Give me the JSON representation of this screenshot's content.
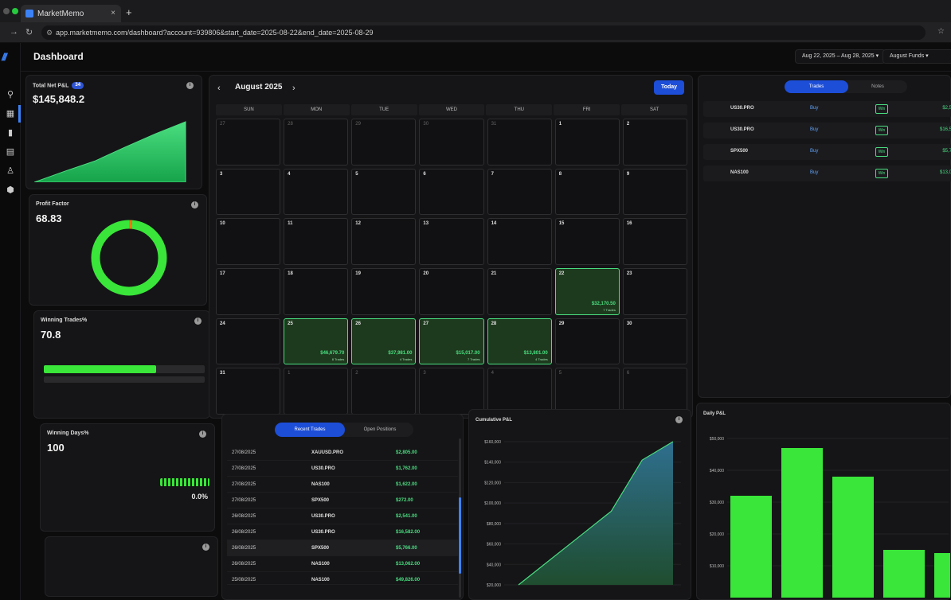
{
  "browser": {
    "tab_title": "MarketMemo",
    "url": "app.marketmemo.com/dashboard?account=939806&start_date=2025-08-22&end_date=2025-08-29"
  },
  "header": {
    "title": "Dashboard",
    "date_range": "Aug 22, 2025 – Aug 28, 2025 ▾",
    "account": "August Funds ▾"
  },
  "stats": {
    "net_pnl": {
      "label": "Total Net P&L",
      "badge": "34",
      "value": "$145,848.2"
    },
    "profit_factor": {
      "label": "Profit Factor",
      "value": "68.83"
    },
    "winning_trades": {
      "label": "Winning Trades%",
      "value": "70.8"
    },
    "winning_days": {
      "label": "Winning Days%",
      "value": "100",
      "side_value": "0.0%"
    }
  },
  "calendar": {
    "month": "August 2025",
    "today_label": "Today",
    "weekdays": [
      "SUN",
      "MON",
      "TUE",
      "WED",
      "THU",
      "FRI",
      "SAT"
    ],
    "days": [
      {
        "n": "27",
        "out": true
      },
      {
        "n": "28",
        "out": true
      },
      {
        "n": "29",
        "out": true
      },
      {
        "n": "30",
        "out": true
      },
      {
        "n": "31",
        "out": true
      },
      {
        "n": "1"
      },
      {
        "n": "2"
      },
      {
        "n": "3"
      },
      {
        "n": "4"
      },
      {
        "n": "5"
      },
      {
        "n": "6"
      },
      {
        "n": "7"
      },
      {
        "n": "8"
      },
      {
        "n": "9"
      },
      {
        "n": "10"
      },
      {
        "n": "11"
      },
      {
        "n": "12"
      },
      {
        "n": "13"
      },
      {
        "n": "14"
      },
      {
        "n": "15"
      },
      {
        "n": "16"
      },
      {
        "n": "17"
      },
      {
        "n": "18"
      },
      {
        "n": "19"
      },
      {
        "n": "20"
      },
      {
        "n": "21"
      },
      {
        "n": "22",
        "amt": "$32,170.50",
        "tr": "7 Trades"
      },
      {
        "n": "23"
      },
      {
        "n": "24"
      },
      {
        "n": "25",
        "amt": "$46,679.70",
        "tr": "8 Trades"
      },
      {
        "n": "26",
        "amt": "$37,981.00",
        "tr": "4 Trades"
      },
      {
        "n": "27",
        "amt": "$15,017.00",
        "tr": "7 Trades"
      },
      {
        "n": "28",
        "amt": "$13,801.00",
        "tr": "4 Trades"
      },
      {
        "n": "29"
      },
      {
        "n": "30"
      },
      {
        "n": "31"
      },
      {
        "n": "1",
        "out": true
      },
      {
        "n": "2",
        "out": true
      },
      {
        "n": "3",
        "out": true
      },
      {
        "n": "4",
        "out": true
      },
      {
        "n": "5",
        "out": true
      },
      {
        "n": "6",
        "out": true
      }
    ]
  },
  "trades_panel": {
    "tab_active": "Trades",
    "tab_inactive": "Notes",
    "rows": [
      {
        "symbol": "US30.PRO",
        "side": "Buy",
        "result": "Win",
        "amount": "$2,5"
      },
      {
        "symbol": "US30.PRO",
        "side": "Buy",
        "result": "Win",
        "amount": "$16,5"
      },
      {
        "symbol": "SPX500",
        "side": "Buy",
        "result": "Win",
        "amount": "$5,7"
      },
      {
        "symbol": "NAS100",
        "side": "Buy",
        "result": "Win",
        "amount": "$13,0"
      }
    ]
  },
  "recent": {
    "tab_active": "Recent Trades",
    "tab_inactive": "Open Positions",
    "rows": [
      {
        "date": "27/08/2025",
        "symbol": "XAUUSD.PRO",
        "pnl": "$2,805.00"
      },
      {
        "date": "27/08/2025",
        "symbol": "US30.PRO",
        "pnl": "$1,762.00"
      },
      {
        "date": "27/08/2025",
        "symbol": "NAS100",
        "pnl": "$1,622.00"
      },
      {
        "date": "27/08/2025",
        "symbol": "SPX500",
        "pnl": "$272.00"
      },
      {
        "date": "26/08/2025",
        "symbol": "US30.PRO",
        "pnl": "$2,541.00"
      },
      {
        "date": "26/08/2025",
        "symbol": "US30.PRO",
        "pnl": "$16,582.00"
      },
      {
        "date": "26/08/2025",
        "symbol": "SPX500",
        "pnl": "$5,766.00"
      },
      {
        "date": "26/08/2025",
        "symbol": "NAS100",
        "pnl": "$13,062.00"
      },
      {
        "date": "25/08/2025",
        "symbol": "NAS100",
        "pnl": "$49,826.00"
      }
    ]
  },
  "cumulative": {
    "title": "Cumulative P&L",
    "yticks": [
      "$160,000",
      "$140,000",
      "$120,000",
      "$100,000",
      "$80,000",
      "$60,000",
      "$40,000",
      "$20,000"
    ]
  },
  "daily": {
    "title": "Daily P&L",
    "yticks": [
      "$50,000",
      "$40,000",
      "$30,000",
      "$20,000",
      "$10,000"
    ]
  },
  "chart_data": [
    {
      "type": "area",
      "values": [
        0,
        18,
        35,
        58,
        80,
        100
      ],
      "ylim": [
        0,
        100
      ]
    },
    {
      "type": "pie",
      "values": [
        98.6,
        1.4
      ]
    },
    {
      "type": "area",
      "x": [
        0,
        1,
        2,
        3,
        4,
        5
      ],
      "values": [
        20000,
        44000,
        68000,
        92000,
        142000,
        162000
      ],
      "ylim": [
        20000,
        160000
      ]
    },
    {
      "type": "bar",
      "values": [
        32000,
        47000,
        38000,
        15000,
        14000
      ],
      "ylim": [
        10000,
        50000
      ]
    }
  ],
  "progress": {
    "winning_trades_fraction": 0.7,
    "winning_days_fraction": 1.0
  }
}
